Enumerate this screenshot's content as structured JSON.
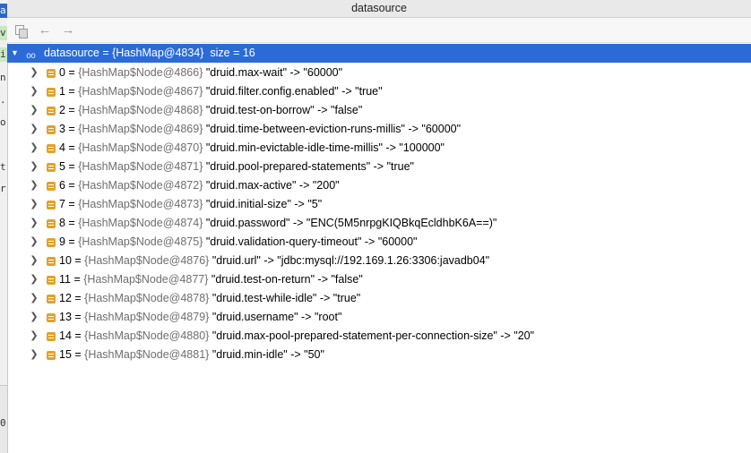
{
  "window": {
    "title": "datasource"
  },
  "gutter_chars": [
    "a",
    "v",
    "i",
    "n",
    ".",
    "o",
    "",
    "t",
    "r"
  ],
  "gutter_bottom_char": "0",
  "toolbar": {
    "copy_icon": "copy-icon",
    "back_icon": "arrow-left-icon",
    "forward_icon": "arrow-right-icon"
  },
  "tree": {
    "root": {
      "label": "datasource = {HashMap@4834}  size = 16",
      "expanded": true
    },
    "entries": [
      {
        "index": "0 = ",
        "type": "{HashMap$Node@4866} ",
        "key": "\"druid.max-wait\"",
        "arrow": " -> ",
        "value": "\"60000\""
      },
      {
        "index": "1 = ",
        "type": "{HashMap$Node@4867} ",
        "key": "\"druid.filter.config.enabled\"",
        "arrow": " -> ",
        "value": "\"true\""
      },
      {
        "index": "2 = ",
        "type": "{HashMap$Node@4868} ",
        "key": "\"druid.test-on-borrow\"",
        "arrow": " -> ",
        "value": "\"false\""
      },
      {
        "index": "3 = ",
        "type": "{HashMap$Node@4869} ",
        "key": "\"druid.time-between-eviction-runs-millis\"",
        "arrow": " -> ",
        "value": "\"60000\""
      },
      {
        "index": "4 = ",
        "type": "{HashMap$Node@4870} ",
        "key": "\"druid.min-evictable-idle-time-millis\"",
        "arrow": " -> ",
        "value": "\"100000\""
      },
      {
        "index": "5 = ",
        "type": "{HashMap$Node@4871} ",
        "key": "\"druid.pool-prepared-statements\"",
        "arrow": " -> ",
        "value": "\"true\""
      },
      {
        "index": "6 = ",
        "type": "{HashMap$Node@4872} ",
        "key": "\"druid.max-active\"",
        "arrow": " -> ",
        "value": "\"200\""
      },
      {
        "index": "7 = ",
        "type": "{HashMap$Node@4873} ",
        "key": "\"druid.initial-size\"",
        "arrow": " -> ",
        "value": "\"5\""
      },
      {
        "index": "8 = ",
        "type": "{HashMap$Node@4874} ",
        "key": "\"druid.password\"",
        "arrow": " -> ",
        "value": "\"ENC(5M5nrpgKIQBkqEcldhbK6A==)\""
      },
      {
        "index": "9 = ",
        "type": "{HashMap$Node@4875} ",
        "key": "\"druid.validation-query-timeout\"",
        "arrow": " -> ",
        "value": "\"60000\""
      },
      {
        "index": "10 = ",
        "type": "{HashMap$Node@4876} ",
        "key": "\"druid.url\"",
        "arrow": " -> ",
        "value": "\"jdbc:mysql://192.169.1.26:3306:javadb04\""
      },
      {
        "index": "11 = ",
        "type": "{HashMap$Node@4877} ",
        "key": "\"druid.test-on-return\"",
        "arrow": " -> ",
        "value": "\"false\""
      },
      {
        "index": "12 = ",
        "type": "{HashMap$Node@4878} ",
        "key": "\"druid.test-while-idle\"",
        "arrow": " -> ",
        "value": "\"true\""
      },
      {
        "index": "13 = ",
        "type": "{HashMap$Node@4879} ",
        "key": "\"druid.username\"",
        "arrow": " -> ",
        "value": "\"root\""
      },
      {
        "index": "14 = ",
        "type": "{HashMap$Node@4880} ",
        "key": "\"druid.max-pool-prepared-statement-per-connection-size\"",
        "arrow": " -> ",
        "value": "\"20\""
      },
      {
        "index": "15 = ",
        "type": "{HashMap$Node@4881} ",
        "key": "\"druid.min-idle\"",
        "arrow": " -> ",
        "value": "\"50\""
      }
    ]
  },
  "colors": {
    "selection": "#2b6bd8",
    "field_icon": "#e3a128",
    "type_text": "#6e6e6e"
  }
}
